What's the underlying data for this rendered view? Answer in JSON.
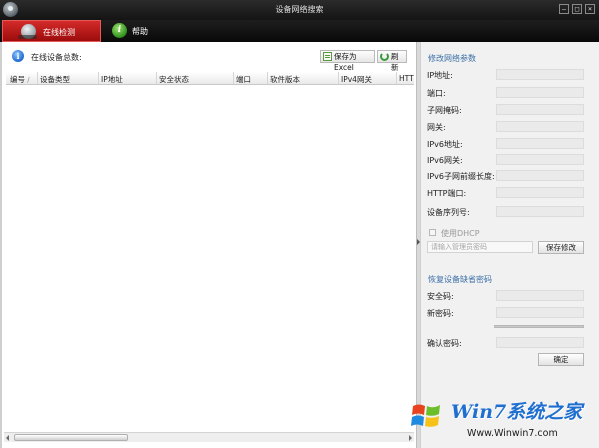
{
  "window": {
    "title": "设备网络搜索",
    "min_glyph": "–",
    "max_glyph": "□",
    "close_glyph": "×"
  },
  "tabs": [
    {
      "label": "在线检测",
      "active": true
    },
    {
      "label": "帮助",
      "active": false
    }
  ],
  "left_panel": {
    "total_label": "在线设备总数:",
    "export_button": "保存为Excel",
    "refresh_button": "刷新",
    "columns": [
      "编号",
      "设备类型",
      "IP地址",
      "安全状态",
      "端口",
      "软件版本",
      "IPv4网关",
      "HTT"
    ],
    "rows": []
  },
  "right_panel": {
    "modify_title": "修改网络参数",
    "fields": [
      {
        "label": "IP地址:",
        "value": ""
      },
      {
        "label": "端口:",
        "value": ""
      },
      {
        "label": "子网掩码:",
        "value": ""
      },
      {
        "label": "网关:",
        "value": ""
      },
      {
        "label": "IPv6地址:",
        "value": ""
      },
      {
        "label": "IPv6网关:",
        "value": ""
      },
      {
        "label": "IPv6子网前缀长度:",
        "value": ""
      },
      {
        "label": "HTTP端口:",
        "value": ""
      },
      {
        "label": "设备序列号:",
        "value": ""
      }
    ],
    "dhcp_label": "使用DHCP",
    "dhcp_checked": false,
    "admin_password_placeholder": "请输入管理员密码",
    "save_button": "保存修改",
    "restore_title": "恢复设备缺省密码",
    "restore_fields": [
      {
        "label": "安全码:",
        "value": ""
      },
      {
        "label": "新密码:",
        "value": ""
      },
      {
        "label": "确认密码:",
        "value": ""
      }
    ],
    "confirm_button": "确定"
  },
  "watermark": {
    "title": "Win7系统之家",
    "url": "Www.Winwin7.com"
  },
  "colors": {
    "active_tab": "#c41a1a",
    "titlebar": "#1e1e1e",
    "section_title": "#3a6fa8"
  },
  "icons": {
    "app": "monitor-icon",
    "tab_online": "monitor-icon",
    "tab_help": "info-icon",
    "total": "info-icon",
    "export": "excel-icon",
    "refresh": "refresh-icon"
  }
}
